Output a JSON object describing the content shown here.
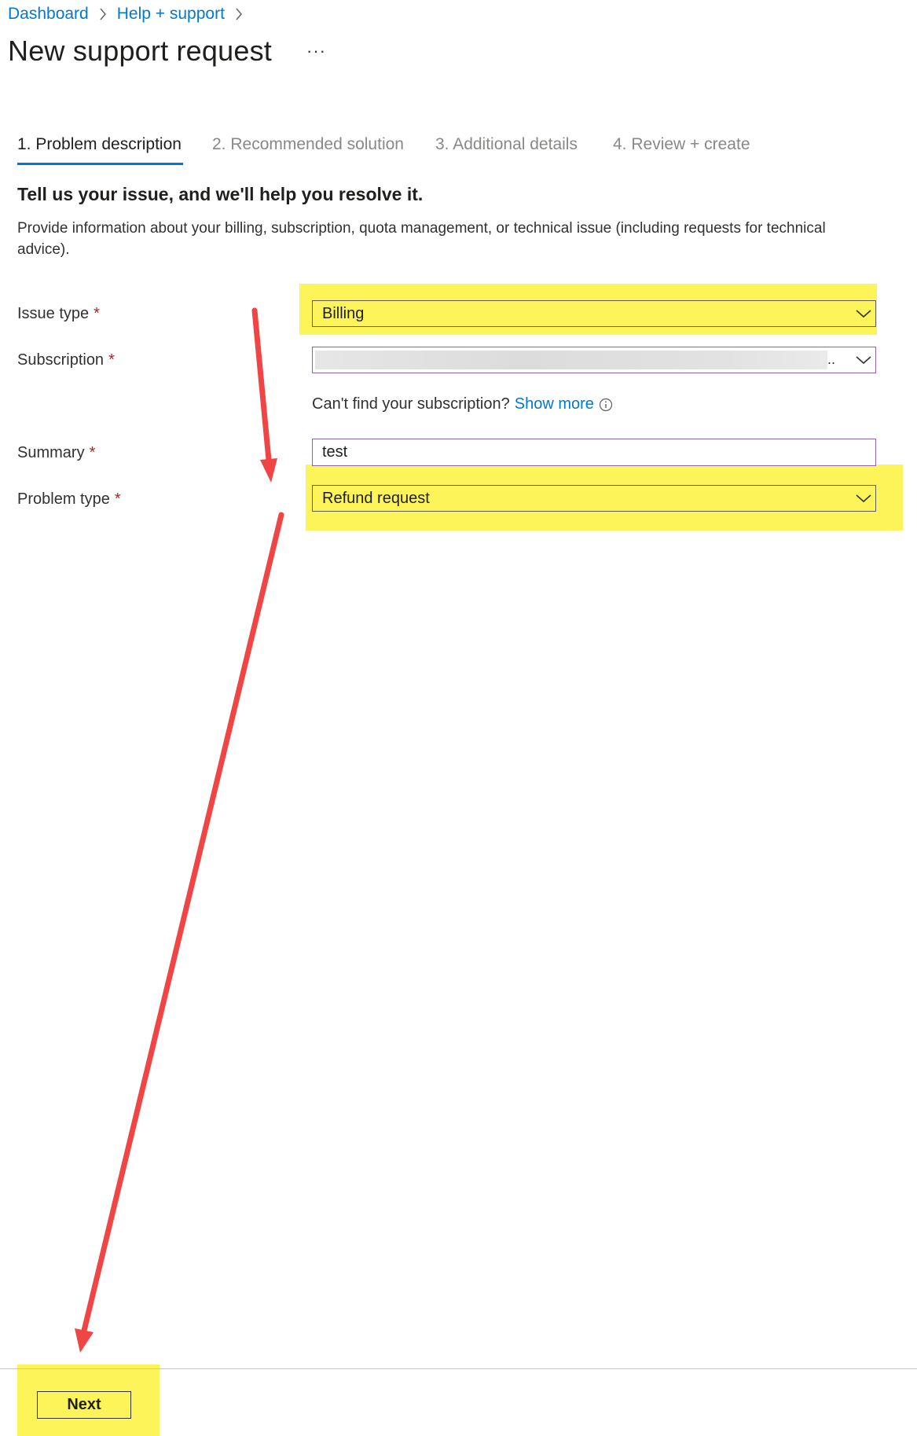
{
  "breadcrumb": [
    "Dashboard",
    "Help + support"
  ],
  "page_title": "New support request",
  "more_actions": "···",
  "tabs": [
    {
      "label": "1. Problem description",
      "active": true
    },
    {
      "label": "2. Recommended solution",
      "active": false
    },
    {
      "label": "3. Additional details",
      "active": false
    },
    {
      "label": "4. Review + create",
      "active": false
    }
  ],
  "heading": "Tell us your issue, and we'll help you resolve it.",
  "description": "Provide information about your billing, subscription, quota management, or technical issue (including requests for technical advice).",
  "form": {
    "required_marker": "*",
    "issue_type": {
      "label": "Issue type",
      "value": "Billing"
    },
    "subscription": {
      "label": "Subscription",
      "value_suffix": ".."
    },
    "subscription_help": {
      "text": "Can't find your subscription?",
      "link": "Show more"
    },
    "summary": {
      "label": "Summary",
      "value": "test"
    },
    "problem_type": {
      "label": "Problem type",
      "value": "Refund request"
    }
  },
  "footer": {
    "next_label": "Next"
  },
  "colors": {
    "accent": "#0078d4",
    "highlight": "#fdf45a",
    "annotation_arrow": "#f04545",
    "required": "#a4262c"
  },
  "icons": {
    "breadcrumb_separator": "chevron-right-icon",
    "dropdown": "chevron-down-icon",
    "info": "info-icon",
    "more": "more-icon"
  }
}
